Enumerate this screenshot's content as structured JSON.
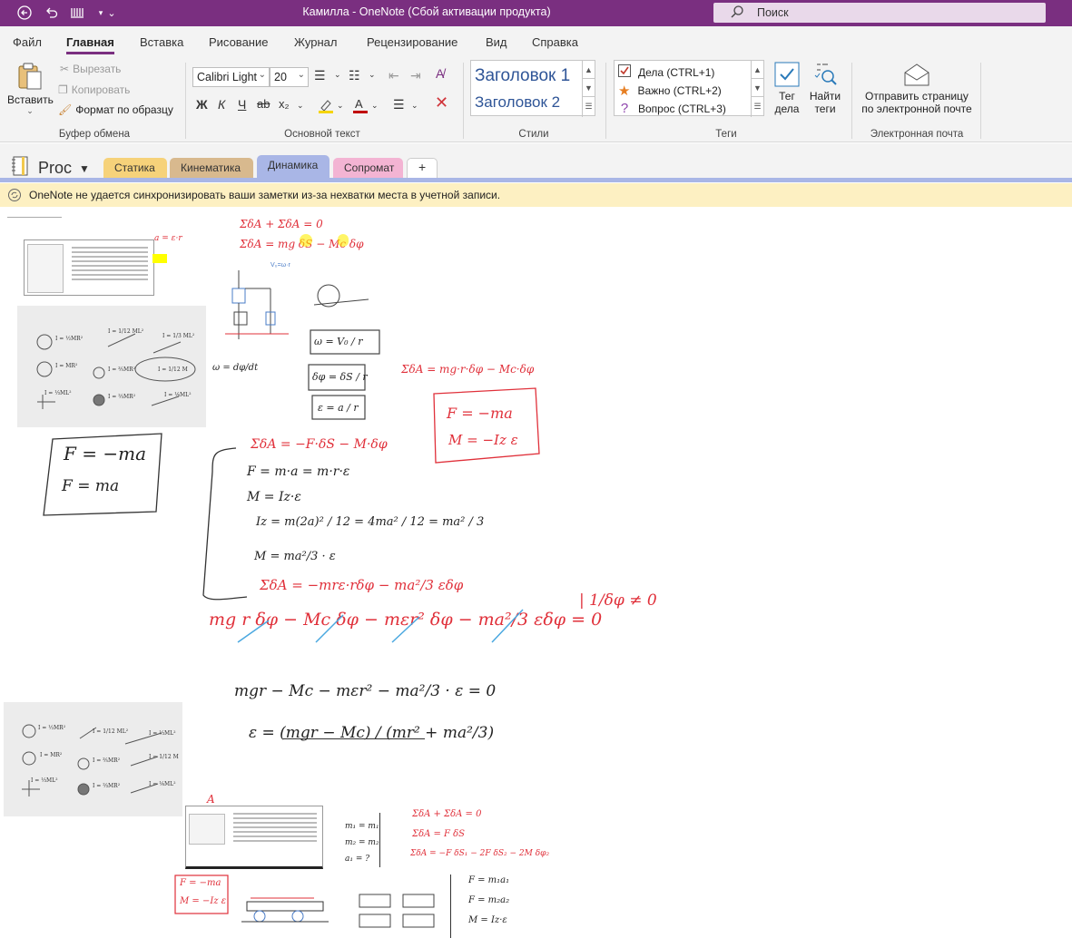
{
  "app": {
    "title": "Камилла  -  OneNote (Сбой активации продукта)",
    "search_placeholder": "Поиск"
  },
  "menu": {
    "tabs": [
      "Файл",
      "Главная",
      "Вставка",
      "Рисование",
      "Журнал",
      "Рецензирование",
      "Вид",
      "Справка"
    ],
    "active": "Главная"
  },
  "ribbon": {
    "clipboard": {
      "paste": "Вставить",
      "cut": "Вырезать",
      "copy": "Копировать",
      "format_painter": "Формат по образцу",
      "label": "Буфер обмена"
    },
    "basic_text": {
      "font": "Calibri Light",
      "size": "20",
      "label": "Основной текст",
      "bold": "Ж",
      "italic": "К",
      "underline": "Ч",
      "strike": "ab",
      "subscript": "x₂"
    },
    "styles": {
      "h1": "Заголовок 1",
      "h2": "Заголовок 2",
      "label": "Стили"
    },
    "tags": {
      "items": [
        "Дела (CTRL+1)",
        "Важно (CTRL+2)",
        "Вопрос (CTRL+3)"
      ],
      "todo_tag": [
        "Тег",
        "дела"
      ],
      "find_tags": [
        "Найти",
        "теги"
      ],
      "label": "Теги"
    },
    "email": {
      "send": [
        "Отправить страницу",
        "по электронной почте"
      ],
      "label": "Электронная почта"
    }
  },
  "notebook": {
    "name": "Proc",
    "sections": [
      {
        "label": "Статика",
        "color": "#f6d27a"
      },
      {
        "label": "Кинематика",
        "color": "#d8b98e"
      },
      {
        "label": "Динамика",
        "color": "#a9b6e6"
      },
      {
        "label": "Сопромат",
        "color": "#f3b4d3"
      }
    ],
    "add_section": "+",
    "active": "Динамика"
  },
  "warning": {
    "text": "OneNote не удается синхронизировать ваши заметки из-за нехватки места в учетной записи."
  },
  "page_notes": {
    "eq1": "ΣδA + ΣδA = 0",
    "eq2": "ΣδA = mg δS − Mc δφ",
    "fi_box": [
      "F = −ma",
      "F = ma"
    ],
    "red_box": [
      "F = −ma",
      "M = −Iz ε"
    ],
    "red_eq": "ΣδA = mg·r·δφ − Mc·δφ",
    "sum1": "ΣδA = −F·δS − M·δφ",
    "f1": "F = m·a = m·r·ε",
    "m1": "M = Iz·ε",
    "iz": "Iz = m(2a)² / 12 = 4ma² / 12 = ma² / 3",
    "mu": "M = ma²/3 · ε",
    "sum2": "ΣδA = −mrε·rδφ − ma²/3 εδφ",
    "big": "mg r δφ − Mc δφ − mεr² δφ − ma²/3 εδφ = 0",
    "div": "| 1/δφ ≠ 0",
    "eq3": "mgr − Mc − mεr² − ma²/3 · ε = 0",
    "eps": "ε = (mgr − Mc) / (mr² + ma²/3)",
    "w_eq": "ω = dφ/dt",
    "w_box": [
      "ω = V₀ / r",
      "δφ = δS / r",
      "ε = a / r"
    ],
    "right_list": [
      "ΣδA + ΣδA = 0",
      "ΣδA = F δS",
      "ΣδA = −F δS₁ − 2F δS₂ − 2M δφ₂"
    ],
    "mini_eqs": [
      "F = m₁a₁",
      "F = m₂a₂",
      "M = Iz·ε"
    ],
    "mass_eqs": [
      "m₁ = m₁",
      "m₂ = m₂",
      "a₁ = ?"
    ]
  }
}
